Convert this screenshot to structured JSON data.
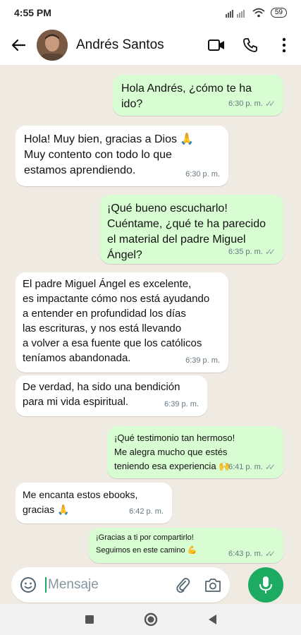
{
  "status": {
    "time": "4:55 PM",
    "battery": "59"
  },
  "header": {
    "contact_name": "Andrés Santos"
  },
  "messages": [
    {
      "dir": "out",
      "text": "Hola Andrés, ¿cómo te ha ido?",
      "time": "6:30 p. m."
    },
    {
      "dir": "in",
      "text": "Hola! Muy bien, gracias a Dios 🙏\nMuy contento con todo lo que\nestamos aprendiendo.",
      "time": "6:30 p. m."
    },
    {
      "dir": "out",
      "text": "¡Qué bueno escucharlo!\nCuéntame, ¿qué te ha parecido\nel material del padre Miguel Ángel?",
      "time": "6:35 p. m."
    },
    {
      "dir": "in",
      "text": "El padre Miguel Ángel es excelente,\nes impactante cómo nos está ayudando\na entender en profundidad los días\nlas escrituras, y nos está llevando\na volver a esa fuente que los católicos\nteníamos abandonada.",
      "time": "6:39 p. m."
    },
    {
      "dir": "in",
      "text": "De verdad, ha sido una bendición\npara mi vida espiritual.",
      "time": "6:39 p. m."
    },
    {
      "dir": "out",
      "text": "¡Qué testimonio tan hermoso!\nMe alegra mucho que estés\nteniendo esa experiencia 🙌",
      "time": "6:41 p. m."
    },
    {
      "dir": "in",
      "text": "Me encanta estos ebooks,\ngracias 🙏",
      "time": "6:42 p. m."
    },
    {
      "dir": "out",
      "text": "¡Gracias a ti por compartirlo!\nSeguimos en este camino 💪",
      "time": "6:43 p. m."
    }
  ],
  "composer": {
    "placeholder": "Mensaje"
  },
  "colors": {
    "outgoing_bubble": "#d9fdd3",
    "incoming_bubble": "#ffffff",
    "accent": "#1daa61",
    "chat_bg": "#efeae2"
  }
}
